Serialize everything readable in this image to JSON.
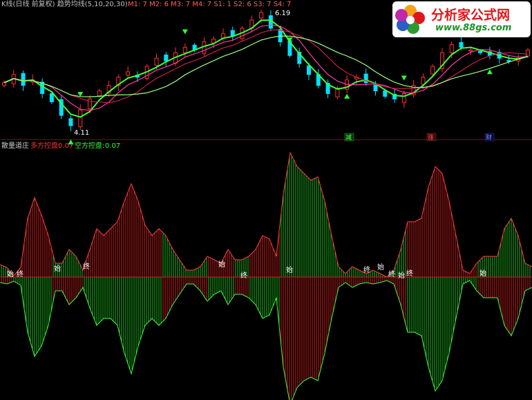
{
  "top_panel": {
    "header": "K线(日线 前复权) 趋势均线(5,10,20,30)",
    "ma_readout": "M1: 7  M2: 6  M3: 7  M4: 7  S1: 1  S2: 6  S3: 7  S4: 7",
    "high_label": "6.19",
    "low_label": "4.11",
    "signals": [
      "减",
      "涨",
      "财"
    ]
  },
  "bottom_panel": {
    "title": "散量道庄",
    "long_label": "多方控盘:",
    "long_value": "0.07",
    "short_label": "空方控盘:",
    "short_value": "0.07"
  },
  "watermark": {
    "name": "分析家公式网",
    "url": "www.88gs.com"
  },
  "colors": {
    "up": "#ff3030",
    "down": "#30ff30",
    "ma_green": "#3cff3c",
    "ma_pink": "#ff3c9c",
    "ma_red": "#c8204a",
    "ma_lightgreen": "#a0ff80",
    "divider": "#8a1010",
    "text_white": "#ffffff",
    "signal_yellow": "#ffff00"
  },
  "chart_data": [
    {
      "type": "candlestick",
      "title": "K线(日线 前复权) 趋势均线(5,10,20,30)",
      "annotations": [
        "6.19",
        "4.11",
        "减",
        "涨",
        "财"
      ],
      "ylim": [
        4.11,
        6.19
      ],
      "closes": [
        4.9,
        5.05,
        4.85,
        4.95,
        4.7,
        4.55,
        4.3,
        4.11,
        4.4,
        4.6,
        4.75,
        4.85,
        5.0,
        5.1,
        5.0,
        5.2,
        5.35,
        5.3,
        5.45,
        5.55,
        5.5,
        5.65,
        5.7,
        5.8,
        5.75,
        5.9,
        6.05,
        6.19,
        5.9,
        5.65,
        5.4,
        5.25,
        5.05,
        4.85,
        4.7,
        4.8,
        4.95,
        5.0,
        4.9,
        4.75,
        4.65,
        4.6,
        4.7,
        4.85,
        5.0,
        5.2,
        5.45,
        5.6,
        5.55,
        5.5,
        5.45,
        5.4,
        5.35,
        5.3,
        5.35,
        5.5
      ]
    },
    {
      "type": "area",
      "title": "散量道庄",
      "series": [
        {
          "name": "多方控盘",
          "value": 0.07
        },
        {
          "name": "空方控盘",
          "value": 0.07
        }
      ],
      "annotations": [
        "始",
        "终"
      ],
      "x": [
        0,
        10,
        20,
        30,
        40,
        50,
        60,
        70,
        80,
        90,
        100,
        110,
        120,
        130,
        140,
        150,
        160,
        170,
        180,
        190,
        200,
        210,
        220,
        230,
        240,
        250,
        260,
        270,
        280,
        290,
        300,
        310,
        320,
        330,
        340,
        350,
        360,
        370,
        380,
        390,
        400,
        410,
        420,
        430,
        440,
        450,
        460,
        470,
        480,
        490,
        500,
        510,
        520,
        530,
        540,
        550,
        560,
        570,
        580,
        590,
        600,
        610,
        620,
        630,
        640,
        650,
        660,
        670,
        680,
        690,
        700,
        710,
        720,
        730,
        740,
        750,
        760,
        770
      ],
      "upper": [
        18,
        14,
        2,
        14,
        85,
        115,
        90,
        60,
        20,
        20,
        40,
        30,
        10,
        40,
        70,
        60,
        70,
        80,
        110,
        135,
        110,
        75,
        60,
        70,
        60,
        40,
        25,
        10,
        10,
        15,
        30,
        25,
        20,
        40,
        25,
        25,
        30,
        40,
        60,
        55,
        30,
        120,
        180,
        160,
        150,
        140,
        145,
        110,
        60,
        15,
        5,
        15,
        10,
        5,
        10,
        5,
        0,
        10,
        40,
        80,
        80,
        85,
        130,
        160,
        150,
        110,
        60,
        10,
        5,
        20,
        30,
        30,
        30,
        70,
        85,
        60,
        20,
        15
      ],
      "lower": [
        -8,
        -10,
        -6,
        -12,
        -80,
        -115,
        -100,
        -70,
        -20,
        -20,
        -40,
        -30,
        -15,
        -45,
        -70,
        -60,
        -60,
        -70,
        -110,
        -140,
        -100,
        -70,
        -60,
        -70,
        -60,
        -40,
        -25,
        -10,
        -10,
        -20,
        -35,
        -25,
        -20,
        -40,
        -25,
        -25,
        -30,
        -40,
        -60,
        -55,
        -30,
        -130,
        -185,
        -160,
        -150,
        -145,
        -150,
        -110,
        -60,
        -15,
        -8,
        -15,
        -10,
        -8,
        -10,
        -8,
        -5,
        -10,
        -40,
        -80,
        -80,
        -85,
        -130,
        -165,
        -150,
        -110,
        -60,
        -10,
        -5,
        -20,
        -30,
        -30,
        -30,
        -70,
        -85,
        -60,
        -20,
        -15
      ]
    }
  ]
}
